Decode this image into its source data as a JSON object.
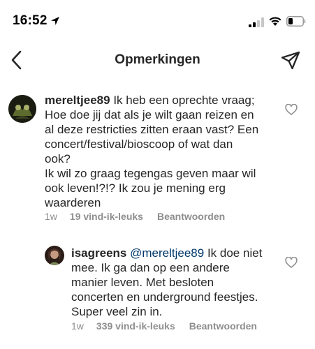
{
  "status_bar": {
    "time": "16:52"
  },
  "header": {
    "title": "Opmerkingen"
  },
  "comments": [
    {
      "username": "mereltjee89",
      "mention": "",
      "lines": [
        "Ik heb een oprechte vraag;",
        "Hoe doe jij dat als je wilt gaan reizen en",
        "al deze restricties zitten eraan vast? Een",
        "concert/festival/bioscoop of wat dan",
        "ook?",
        "Ik wil zo graag tegengas geven maar wil",
        "ook leven!?!? Ik zou je mening erg",
        "waarderen"
      ],
      "age": "1w",
      "likes": "19 vind-ik-leuks",
      "reply": "Beantwoorden"
    },
    {
      "username": "isagreens",
      "mention": "@mereltjee89",
      "lines": [
        "Ik doe niet",
        "mee. Ik ga dan op een andere",
        "manier leven. Met besloten",
        "concerten en underground feestjes.",
        "Super veel zin in."
      ],
      "age": "1w",
      "likes": "339 vind-ik-leuks",
      "reply": "Beantwoorden"
    }
  ],
  "icons": {
    "back": "chevron-left-icon",
    "send": "paper-plane-icon",
    "like": "heart-icon"
  }
}
